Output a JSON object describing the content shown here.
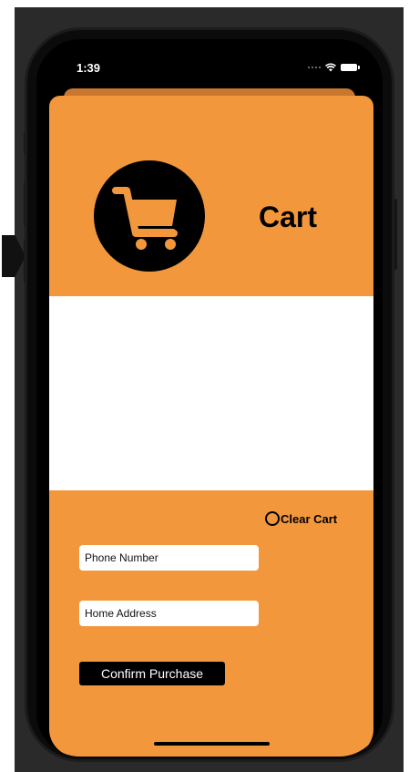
{
  "status_bar": {
    "time": "1:39"
  },
  "header": {
    "title": "Cart",
    "icon": "shopping-cart-icon"
  },
  "clear_cart": {
    "label": "Clear Cart"
  },
  "form": {
    "phone_placeholder": "Phone Number",
    "address_placeholder": "Home Address",
    "confirm_label": "Confirm Purchase"
  },
  "colors": {
    "accent": "#f3973d",
    "background": "#ffffff",
    "button": "#000000"
  }
}
